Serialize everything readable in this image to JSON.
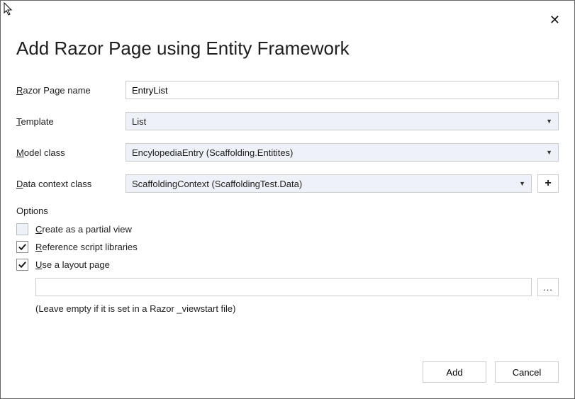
{
  "dialog": {
    "title": "Add Razor Page using Entity Framework"
  },
  "fields": {
    "razor_page_name": {
      "label_pre": "R",
      "label_rest": "azor Page name",
      "value": "EntryList"
    },
    "template": {
      "label_pre": "T",
      "label_rest": "emplate",
      "value": "List"
    },
    "model_class": {
      "label_pre": "M",
      "label_rest": "odel class",
      "value": "EncylopediaEntry (Scaffolding.Entitites)"
    },
    "data_context_class": {
      "label_pre": "D",
      "label_rest": "ata context class",
      "value": "ScaffoldingContext (ScaffoldingTest.Data)"
    }
  },
  "options": {
    "label": "Options",
    "create_partial": {
      "label_pre": "C",
      "label_rest": "reate as a partial view",
      "checked": false
    },
    "reference_scripts": {
      "label_pre": "R",
      "label_rest": "eference script libraries",
      "checked": true
    },
    "use_layout": {
      "label_pre": "U",
      "label_rest": "se a layout page",
      "checked": true
    },
    "layout_path": "",
    "hint": "(Leave empty if it is set in a Razor _viewstart file)"
  },
  "buttons": {
    "add": "Add",
    "cancel": "Cancel",
    "plus": "+",
    "browse": "..."
  }
}
